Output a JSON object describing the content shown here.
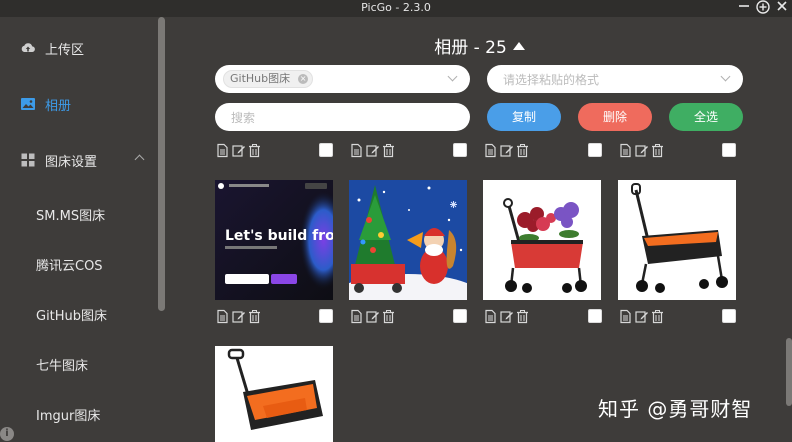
{
  "window": {
    "title": "PicGo - 2.3.0"
  },
  "sidebar": {
    "items": [
      {
        "label": "上传区",
        "icon": "cloud-upload-icon"
      },
      {
        "label": "相册",
        "icon": "image-icon"
      },
      {
        "label": "图床设置",
        "icon": "grid-icon"
      }
    ],
    "sub_items": [
      "SM.MS图床",
      "腾讯云COS",
      "GitHub图床",
      "七牛图床",
      "Imgur图床"
    ]
  },
  "gallery": {
    "title": "相册 - 25",
    "picbed_tag": "GitHub图床",
    "format_placeholder": "请选择粘贴的格式",
    "search_placeholder": "搜索",
    "copy_label": "复制",
    "delete_label": "删除",
    "select_all_label": "全选"
  },
  "images": [
    {
      "name": "lets-build-banner",
      "caption": "Let's build from here"
    },
    {
      "name": "christmas-wagon",
      "caption": ""
    },
    {
      "name": "flower-wagon",
      "caption": ""
    },
    {
      "name": "orange-wagon-side",
      "caption": ""
    },
    {
      "name": "orange-wagon-front",
      "caption": ""
    }
  ],
  "colors": {
    "accent": "#3d9be8",
    "copy": "#4a9ee8",
    "delete": "#ef6b5d",
    "select_all": "#3fae63"
  },
  "watermark": "知乎 @勇哥财智"
}
